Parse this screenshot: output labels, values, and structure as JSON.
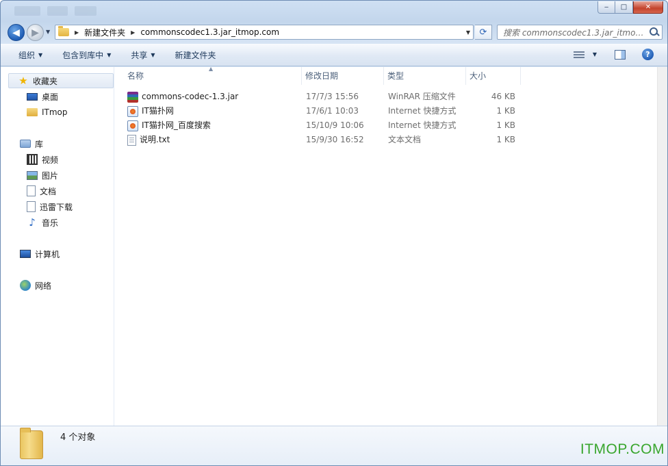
{
  "window": {
    "controls": {
      "minimize": "‒",
      "maximize": "□",
      "close": "✕"
    }
  },
  "address": {
    "crumbs": [
      "新建文件夹",
      "commonscodec1.3.jar_itmop.com"
    ],
    "search_placeholder": "搜索 commonscodec1.3.jar_itmop...."
  },
  "toolbar": {
    "organize": "组织",
    "include_in_library": "包含到库中",
    "share": "共享",
    "new_folder": "新建文件夹"
  },
  "nav": {
    "favorites": {
      "label": "收藏夹",
      "items": [
        "桌面",
        "ITmop"
      ]
    },
    "libraries": {
      "label": "库",
      "items": [
        "视频",
        "图片",
        "文档",
        "迅雷下载",
        "音乐"
      ]
    },
    "computer": "计算机",
    "network": "网络"
  },
  "columns": {
    "name": "名称",
    "date": "修改日期",
    "type": "类型",
    "size": "大小"
  },
  "files": [
    {
      "name": "commons-codec-1.3.jar",
      "date": "17/7/3 15:56",
      "type": "WinRAR 压缩文件",
      "size": "46 KB",
      "icon": "winrar-archive-icon"
    },
    {
      "name": "IT猫扑网",
      "date": "17/6/1 10:03",
      "type": "Internet 快捷方式",
      "size": "1 KB",
      "icon": "internet-shortcut-icon"
    },
    {
      "name": "IT猫扑网_百度搜索",
      "date": "15/10/9 10:06",
      "type": "Internet 快捷方式",
      "size": "1 KB",
      "icon": "internet-shortcut-icon"
    },
    {
      "name": "说明.txt",
      "date": "15/9/30 16:52",
      "type": "文本文档",
      "size": "1 KB",
      "icon": "text-document-icon"
    }
  ],
  "details": {
    "object_count": "4 个对象"
  },
  "watermark": "ITMOP.COM"
}
